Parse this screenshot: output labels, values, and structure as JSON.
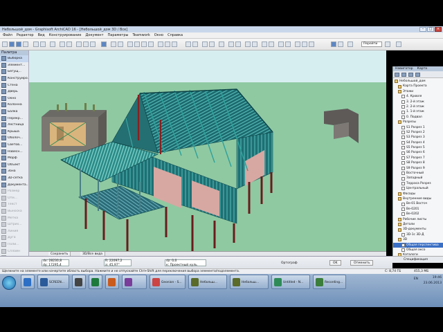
{
  "window": {
    "title": "Небольшой_дом - Graphisoft ArchiCAD 16 - [Небольшой_дом 3D / Все]",
    "buttons": [
      "minimize",
      "maximize",
      "close"
    ]
  },
  "menu": [
    "Файл",
    "Редактор",
    "Вид",
    "Конструирование",
    "Документ",
    "Параметры",
    "Teamwork",
    "Окно",
    "Справка"
  ],
  "toolbar": {
    "nav_dropdown": "Перейти"
  },
  "toolbox": {
    "header": "Палитра",
    "items": [
      {
        "label": "Выборка",
        "active": true
      },
      {
        "label": "Элемент...",
        "active": true
      },
      {
        "label": "Бегущ...",
        "active": true
      },
      {
        "label": "Конструиро...",
        "active": true
      },
      {
        "label": "Стена",
        "active": true
      },
      {
        "label": "Дверь",
        "active": true
      },
      {
        "label": "Окно",
        "active": true
      },
      {
        "label": "Колонна",
        "active": true
      },
      {
        "label": "Балка",
        "active": true
      },
      {
        "label": "Перекр...",
        "active": true
      },
      {
        "label": "Лестница",
        "active": true
      },
      {
        "label": "Крыша",
        "active": true
      },
      {
        "label": "Оболоч...",
        "active": true
      },
      {
        "label": "Светов...",
        "active": true
      },
      {
        "label": "Навесн...",
        "active": true
      },
      {
        "label": "Морф",
        "active": true
      },
      {
        "label": "Объект",
        "active": true
      },
      {
        "label": "Зона",
        "active": true
      },
      {
        "label": "3D-сетка",
        "active": true
      },
      {
        "label": "Документа...",
        "active": true
      },
      {
        "label": "Размер",
        "active": false
      },
      {
        "label": "Отм...",
        "active": false
      },
      {
        "label": "Текст",
        "active": false
      },
      {
        "label": "Выноска",
        "active": false
      },
      {
        "label": "Метка",
        "active": false
      },
      {
        "label": "Штрих...",
        "active": false
      },
      {
        "label": "Линия",
        "active": false
      },
      {
        "label": "Дуга",
        "active": false
      },
      {
        "label": "Поли...",
        "active": false
      },
      {
        "label": "Сплайн",
        "active": false
      },
      {
        "label": "Точка",
        "active": false
      },
      {
        "label": "Рисунок",
        "active": false
      },
      {
        "label": "Разрез",
        "active": false
      },
      {
        "label": "Еще",
        "active": true
      }
    ]
  },
  "view_tabs": [
    "Сохранить",
    "3D/Все вида"
  ],
  "navigator": {
    "tabs": [
      "Навигатор",
      "Карта"
    ],
    "items": [
      {
        "label": "Небольшой_дом",
        "type": "folder",
        "indent": 0
      },
      {
        "label": "Карта Проекта",
        "type": "folder",
        "indent": 1
      },
      {
        "label": "Этажи",
        "type": "folder",
        "indent": 1
      },
      {
        "label": "4. Кровля",
        "type": "plan",
        "indent": 2
      },
      {
        "label": "3. 2-й этаж",
        "type": "plan",
        "indent": 2
      },
      {
        "label": "2. 2-й этаж",
        "type": "plan",
        "indent": 2
      },
      {
        "label": "1. 1-й этаж",
        "type": "plan",
        "indent": 2
      },
      {
        "label": "0. Подвал",
        "type": "plan",
        "indent": 2
      },
      {
        "label": "Разрезы",
        "type": "folder",
        "indent": 1
      },
      {
        "label": "S1 Разрез 1",
        "type": "plan",
        "indent": 2
      },
      {
        "label": "S2 Разрез 2",
        "type": "plan",
        "indent": 2
      },
      {
        "label": "S3 Разрез 3",
        "type": "plan",
        "indent": 2
      },
      {
        "label": "S4 Разрез 4",
        "type": "plan",
        "indent": 2
      },
      {
        "label": "S5 Разрез 5",
        "type": "plan",
        "indent": 2
      },
      {
        "label": "S6 Разрез 6",
        "type": "plan",
        "indent": 2
      },
      {
        "label": "S7 Разрез 7",
        "type": "plan",
        "indent": 2
      },
      {
        "label": "S8 Разрез 8",
        "type": "plan",
        "indent": 2
      },
      {
        "label": "S9 Разрез 9",
        "type": "plan",
        "indent": 2
      },
      {
        "label": "Восточный",
        "type": "plan",
        "indent": 2
      },
      {
        "label": "Западный",
        "type": "plan",
        "indent": 2
      },
      {
        "label": "Терраса Разрез",
        "type": "plan",
        "indent": 2
      },
      {
        "label": "Центральный",
        "type": "plan",
        "indent": 2
      },
      {
        "label": "Фасады",
        "type": "folder",
        "indent": 1
      },
      {
        "label": "Внутренние виды",
        "type": "folder",
        "indent": 1
      },
      {
        "label": "Be-01 Восточ",
        "type": "plan",
        "indent": 2
      },
      {
        "label": "Be-0201",
        "type": "plan",
        "indent": 2
      },
      {
        "label": "Be-0202",
        "type": "plan",
        "indent": 2
      },
      {
        "label": "Рабочие листы",
        "type": "folder",
        "indent": 1
      },
      {
        "label": "Детали",
        "type": "folder",
        "indent": 1
      },
      {
        "label": "3D-документы",
        "type": "folder",
        "indent": 1
      },
      {
        "label": "3D-1с 3D-Д",
        "type": "plan",
        "indent": 2
      },
      {
        "label": "3D",
        "type": "folder",
        "indent": 1
      },
      {
        "label": "Общая перспектива",
        "type": "plan",
        "indent": 2,
        "selected": true
      },
      {
        "label": "Общая аксо",
        "type": "plan",
        "indent": 2
      },
      {
        "label": "Каталоги",
        "type": "folder",
        "indent": 1
      },
      {
        "label": "Список",
        "type": "folder",
        "indent": 1
      }
    ],
    "footer": "Спецификация"
  },
  "infobox": {
    "dx": "dx: 28230,8",
    "dy": "dy: 17295,4",
    "r": "R: 22097,2",
    "a": "a: 45,97°",
    "dz": "dz: 0,0",
    "plane": "к: Проектный нуль",
    "ortho": "Ортограф",
    "ok": "OK",
    "cancel": "Отменить"
  },
  "status": {
    "message": "Щелкните на элементе или начертите область выбора. Нажмите и не отпускайте Ctrl+Shift для переключения выбора элемента/подэлемента.",
    "disk": "С: 8,74 ГБ",
    "mem": "455,3 МБ"
  },
  "taskbar": {
    "tasks": [
      "SCREEN...",
      "",
      "",
      "",
      "Geonion - S...",
      "Небольш...",
      "Небольш...",
      "Untitled - N...",
      "Recording..."
    ],
    "lang": "EN",
    "time": "19:46",
    "date": "23.06.2013"
  },
  "colors": {
    "sky": "#cfe8ec",
    "ground": "#8fc9a2",
    "frame": "#2d8c8a",
    "post": "#6a1b1b",
    "titlebar": "#c9d7ea",
    "taskbar": "#7b9bc2",
    "selection": "#3a6fc4"
  }
}
